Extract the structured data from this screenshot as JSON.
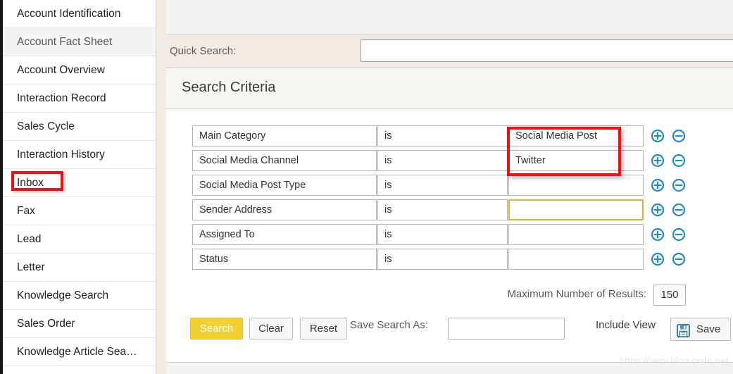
{
  "sidebar": {
    "items": [
      {
        "label": "Account Identification",
        "alt": false
      },
      {
        "label": "Account Fact Sheet",
        "alt": true
      },
      {
        "label": "Account Overview",
        "alt": false
      },
      {
        "label": "Interaction Record",
        "alt": false
      },
      {
        "label": "Sales Cycle",
        "alt": false
      },
      {
        "label": "Interaction History",
        "alt": false
      },
      {
        "label": "Inbox",
        "alt": false
      },
      {
        "label": "Fax",
        "alt": false
      },
      {
        "label": "Lead",
        "alt": false
      },
      {
        "label": "Letter",
        "alt": false
      },
      {
        "label": "Knowledge Search",
        "alt": false
      },
      {
        "label": "Sales Order",
        "alt": false
      },
      {
        "label": "Knowledge Article Sea…",
        "alt": false
      }
    ],
    "highlighted_item": "Inbox"
  },
  "quick_search": {
    "label": "Quick Search:",
    "value": "",
    "placeholder": ""
  },
  "criteria_panel": {
    "title": "Search Criteria",
    "columns": [
      "field",
      "operator",
      "value"
    ],
    "rows": [
      {
        "field": "Main Category",
        "operator": "is",
        "value": "Social Media Post",
        "focused": false,
        "highlighted": true
      },
      {
        "field": "Social Media Channel",
        "operator": "is",
        "value": "Twitter",
        "focused": false,
        "highlighted": true
      },
      {
        "field": "Social Media Post Type",
        "operator": "is",
        "value": "",
        "focused": false,
        "highlighted": false
      },
      {
        "field": "Sender Address",
        "operator": "is",
        "value": "",
        "focused": true,
        "highlighted": false
      },
      {
        "field": "Assigned To",
        "operator": "is",
        "value": "",
        "focused": false,
        "highlighted": false
      },
      {
        "field": "Status",
        "operator": "is",
        "value": "",
        "focused": false,
        "highlighted": false
      }
    ],
    "add_icon": "plus-circle-icon",
    "remove_icon": "minus-circle-icon"
  },
  "max_results": {
    "label": "Maximum Number of Results:",
    "value": "150"
  },
  "actions": {
    "search_label": "Search",
    "clear_label": "Clear",
    "reset_label": "Reset",
    "save_search_as_label": "Save Search As:",
    "save_search_as_value": "",
    "include_view_label": "Include View",
    "save_label": "Save",
    "save_icon": "floppy-disk-icon"
  },
  "watermark": "https://jerry.blog.csdn.net",
  "colors": {
    "search_button": "#f0d033",
    "annotation_red": "#ee1111",
    "focus_border": "#d9b436",
    "icon_blue": "#2288cc",
    "quick_search_band": "#f3ebe2",
    "criteria_header_band": "#f8f6f1"
  }
}
